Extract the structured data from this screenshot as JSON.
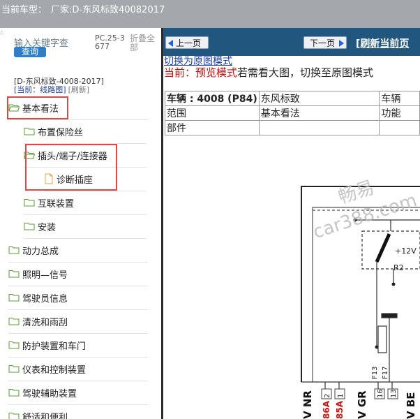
{
  "header": {
    "vehicle_label": "当前车型：",
    "vehicle_value": "厂家:D-东风标致40082017"
  },
  "left": {
    "corner_mark": "∴",
    "search_placeholder": "输入关键字查",
    "query_button": "查询",
    "pc_code": "PC.25-3677",
    "collapse_all": "折叠全部",
    "db_line1": "[D-东风标致-4008-2017]",
    "current_label": "[当前：线路图]",
    "refresh_label": "[刷新]",
    "tree": [
      {
        "label": "基本看法",
        "level": 0,
        "type": "folder-open",
        "highlight": true
      },
      {
        "label": "布置保险丝",
        "level": 1,
        "type": "folder",
        "highlight": false
      },
      {
        "label": "插头/端子/连接器",
        "level": 1,
        "type": "folder-open",
        "highlight": true
      },
      {
        "label": "诊断插座",
        "level": 2,
        "type": "file",
        "highlight": true
      },
      {
        "label": "互联装置",
        "level": 1,
        "type": "folder",
        "highlight": false
      },
      {
        "label": "安装",
        "level": 1,
        "type": "folder",
        "highlight": false
      },
      {
        "label": "动力总成",
        "level": 0,
        "type": "folder",
        "highlight": false
      },
      {
        "label": "照明—信号",
        "level": 0,
        "type": "folder",
        "highlight": false
      },
      {
        "label": "驾驶员信息",
        "level": 0,
        "type": "folder",
        "highlight": false
      },
      {
        "label": "清洗和雨刮",
        "level": 0,
        "type": "folder",
        "highlight": false
      },
      {
        "label": "防护装置和车门",
        "level": 0,
        "type": "folder",
        "highlight": false
      },
      {
        "label": "仪表和控制装置",
        "level": 0,
        "type": "folder",
        "highlight": false
      },
      {
        "label": "驾驶辅助装置",
        "level": 0,
        "type": "folder",
        "highlight": false
      },
      {
        "label": "舒适和便利",
        "level": 0,
        "type": "folder",
        "highlight": false
      }
    ]
  },
  "right": {
    "prev_button": "上一页",
    "next_button": "下一页",
    "refresh_page": "[刷新当前页",
    "switch_link": "切换为原图模式",
    "mode_prefix": "当前：预览模式",
    "mode_suffix": "若需看大图，切换至原图模式",
    "table": [
      [
        "车辆 : 4008 (P84)",
        "东风标致",
        "车辆"
      ],
      [
        "范围",
        "基本看法",
        "功能"
      ],
      [
        "部件",
        "",
        ""
      ]
    ],
    "diagram": {
      "voltage": "+12V",
      "relay": "R2",
      "fuse_a": "F13",
      "fuse_b": "F17",
      "pins_left": [
        "2",
        "1"
      ],
      "pins_right": [
        "16",
        "13"
      ],
      "wire_nr": "V NR",
      "wire_86a": "86A",
      "wire_85a": "85A",
      "wire_gr": "V GR",
      "wire_be": "V BE",
      "watermark_1": "畅易",
      "watermark_2": "car388.com"
    }
  },
  "colors": {
    "nav_bar": "#21577e",
    "highlight": "#e04646",
    "title_bar": "#a4a7ab",
    "link": "#1a3fa8",
    "mode_red": "#cc1111"
  }
}
